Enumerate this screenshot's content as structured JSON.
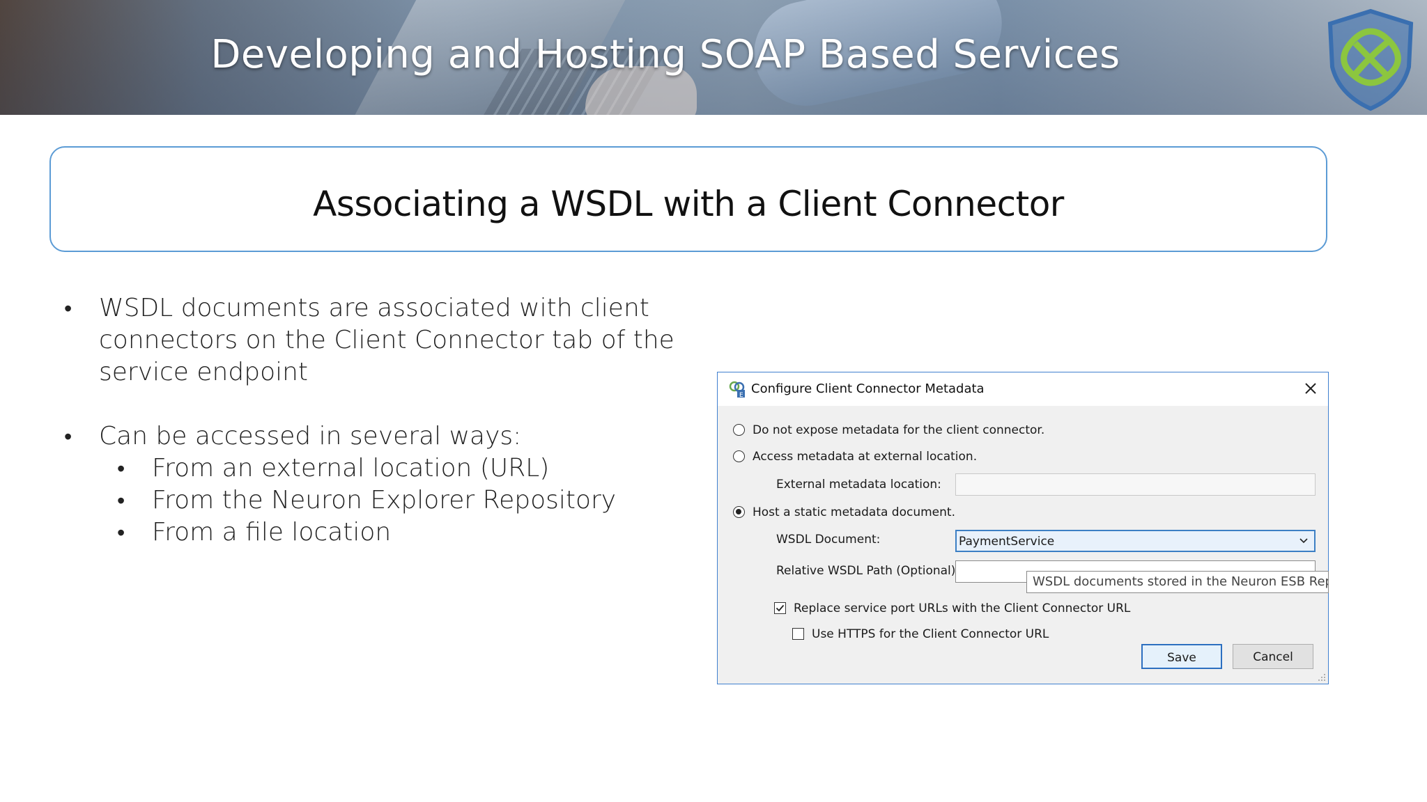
{
  "header": {
    "title": "Developing and Hosting SOAP Based Services",
    "logo_icon": "shield-knot-logo-icon"
  },
  "subtitle": "Associating a WSDL with a Client Connector",
  "bullets": {
    "items": [
      {
        "text": "WSDL documents are associated with client connectors on the Client Connector tab of the service endpoint"
      },
      {
        "text": "Can be accessed in several ways:",
        "sub": [
          "From an external location (URL)",
          "From the Neuron Explorer Repository",
          "From a file location"
        ]
      }
    ],
    "marker": "•"
  },
  "dialog": {
    "title": "Configure Client Connector Metadata",
    "close_icon": "close-icon",
    "options": {
      "no_expose": "Do not expose metadata for the client connector.",
      "external": "Access metadata at external location.",
      "host_static": "Host a static metadata document."
    },
    "selected_option": "host_static",
    "external_location_label": "External metadata location:",
    "external_location_value": "",
    "wsdl_document_label": "WSDL Document:",
    "wsdl_document_value": "PaymentService",
    "relative_path_label": "Relative WSDL Path (Optional):",
    "relative_path_value": "",
    "tooltip": "WSDL documents stored in the Neuron ESB Reposi",
    "replace_urls_label": "Replace service port URLs with the Client Connector URL",
    "replace_urls_checked": true,
    "use_https_label": "Use HTTPS for the Client Connector URL",
    "use_https_checked": false,
    "save_label": "Save",
    "cancel_label": "Cancel"
  },
  "colors": {
    "accent_border": "#5b9bd5",
    "dialog_border": "#3f7fcf",
    "logo_blue": "#3a6fb0",
    "logo_green": "#8cc63f"
  }
}
